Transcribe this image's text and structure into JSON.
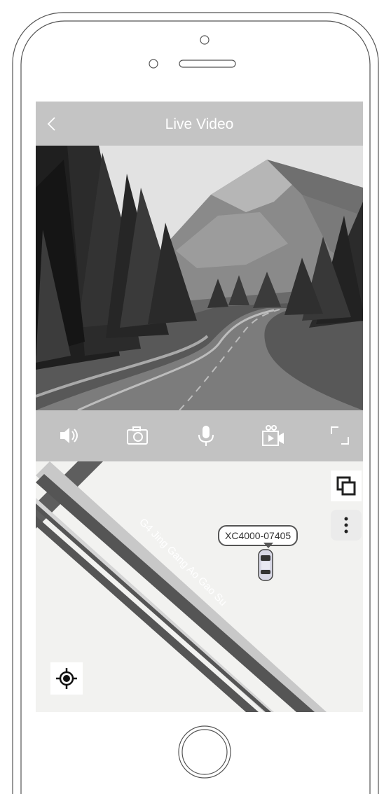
{
  "header": {
    "title": "Live Video",
    "back_icon": "chevron-left-icon"
  },
  "toolbar": {
    "buttons": [
      {
        "icon": "speaker-icon",
        "action": "audio"
      },
      {
        "icon": "camera-icon",
        "action": "snapshot"
      },
      {
        "icon": "microphone-icon",
        "action": "talk"
      },
      {
        "icon": "video-record-icon",
        "action": "record"
      },
      {
        "icon": "fullscreen-icon",
        "action": "fullscreen"
      }
    ]
  },
  "map": {
    "road_label": "G4 Jing Gang Ao Gao Su",
    "vehicle_id": "XC4000-07405",
    "layers_icon": "layers-icon",
    "more_icon": "more-vertical-icon",
    "locate_icon": "locate-icon"
  },
  "colors": {
    "nav_bg": "#c4c4c4",
    "toolbar_bg": "#c2c2c2",
    "toolbar_icon": "#ffffff",
    "map_bg": "#f2f2f0",
    "road_dark": "#555555",
    "road_light": "#c8c8c8"
  }
}
